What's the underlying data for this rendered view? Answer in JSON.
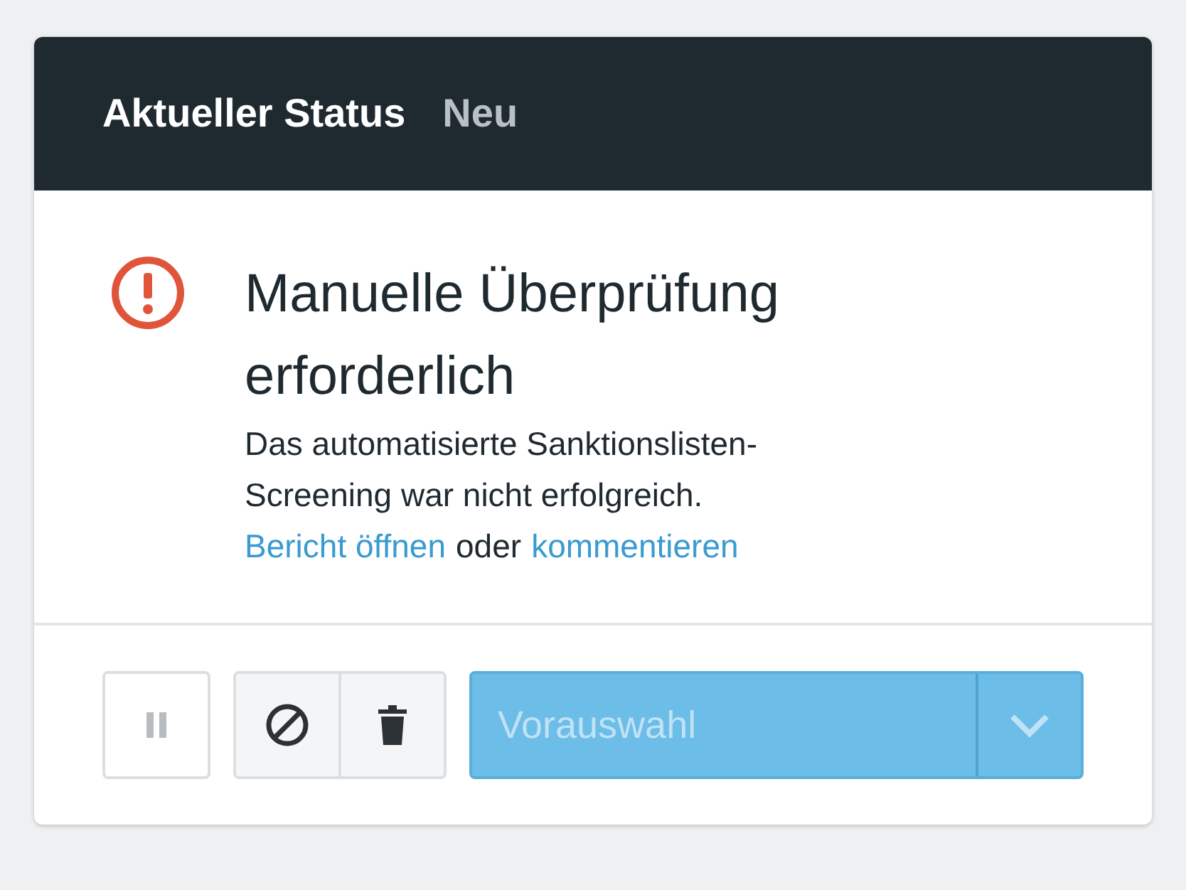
{
  "header": {
    "title": "Aktueller Status",
    "status": "Neu"
  },
  "alert": {
    "heading": "Manuelle Überprüfung erforderlich",
    "description": "Das automatisierte Sanktionslisten-Screening war nicht erfolgreich.",
    "links": [
      {
        "kind": "link",
        "text": "Bericht öffnen"
      },
      {
        "kind": "text",
        "text": "oder"
      },
      {
        "kind": "link",
        "text": "kommentieren"
      }
    ]
  },
  "actions": {
    "button_groups": [
      [
        {
          "kind": "pause",
          "disabled": true
        }
      ],
      [
        {
          "kind": "block",
          "disabled": false
        },
        {
          "kind": "delete",
          "disabled": false
        }
      ]
    ],
    "select": {
      "placeholder": "Vorauswahl",
      "disabled": true
    }
  }
}
